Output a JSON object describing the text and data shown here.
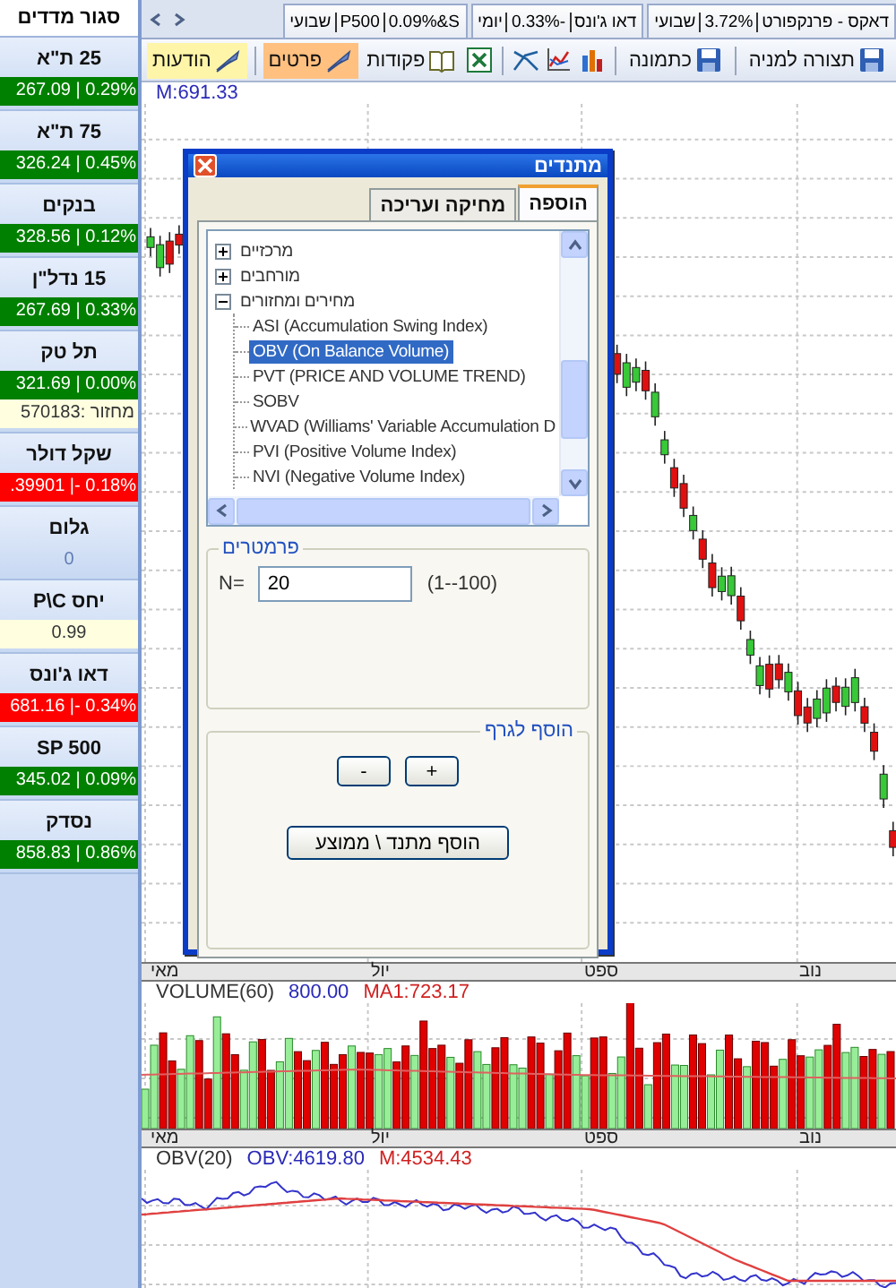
{
  "sidebar": {
    "title": "סגור מדדים",
    "items": [
      {
        "name": "25 ת\"א",
        "value": "267.09 | 0.29%",
        "color": "#008000"
      },
      {
        "name": "75 ת\"א",
        "value": "326.24 | 0.45%",
        "color": "#008000"
      },
      {
        "name": "בנקים",
        "value": "328.56 | 0.12%",
        "color": "#008000"
      },
      {
        "name": "15 נדל\"ן",
        "value": "267.69 | 0.33%",
        "color": "#008000"
      },
      {
        "name": "תל טק",
        "value": "321.69 | 0.00%",
        "color": "#008000",
        "note": "מחזור :570183"
      },
      {
        "name": "שקל דולר",
        "value": ".39901 |- 0.18%",
        "color": "#ff0000"
      },
      {
        "name": "גלום",
        "value": "0"
      },
      {
        "name": "יחס P\\C",
        "value": "0.99",
        "color": "#ffffe0"
      },
      {
        "name": "דאו ג'ונס",
        "value": "681.16 |- 0.34%",
        "color": "#ff0000"
      },
      {
        "name": "SP 500",
        "value": "345.02 | 0.09%",
        "color": "#008000"
      },
      {
        "name": "נסדק",
        "value": "858.83 | 0.86%",
        "color": "#008000"
      }
    ]
  },
  "tabs": [
    {
      "parts": [
        "דאקס - פרנקפורט",
        "3.72%",
        "שבועי"
      ]
    },
    {
      "parts": [
        "דאו ג'ונס",
        "0.33%-",
        "יומי"
      ]
    },
    {
      "parts": [
        "0.09%&S",
        "P500",
        "שבועי"
      ]
    }
  ],
  "toolbar": [
    {
      "label": "תצורה למניה"
    },
    {
      "label": "כתמונה"
    },
    {
      "label": "פקודות"
    },
    {
      "label": "פרטים",
      "color": "#ffc080"
    },
    {
      "label": "הודעות",
      "color": "#fff5a8"
    }
  ],
  "main_chart": {
    "legend": "M:691.33"
  },
  "axis_top": [
    "נוב",
    "ספט",
    "יול",
    "מאי"
  ],
  "volume_panel": {
    "title": "VOLUME(60)",
    "value": "800.00",
    "ma": "MA1:723.17"
  },
  "axis_bottom": [
    "נוב",
    "ספט",
    "יול",
    "מאי"
  ],
  "obv_panel": {
    "title": "OBV(20)",
    "value": "OBV:4619.80",
    "ma": "M:4534.43"
  },
  "dialog": {
    "title": "מתנדים",
    "tabs": [
      {
        "label": "הוספה",
        "selected": true
      },
      {
        "label": "מחיקה ועריכה",
        "selected": false
      }
    ],
    "tree": [
      {
        "label": "מרכזיים",
        "expanded": false,
        "selected": false
      },
      {
        "label": "מורחבים",
        "expanded": false,
        "selected": false
      },
      {
        "label": "מחירים ומחזורים",
        "expanded": true,
        "selected": false,
        "children": [
          {
            "label": "ASI (Accumulation Swing Index)",
            "selected": false
          },
          {
            "label": "OBV (On Balance Volume)",
            "selected": true
          },
          {
            "label": "PVT (PRICE AND VOLUME TREND)",
            "selected": false
          },
          {
            "label": "SOBV",
            "selected": false
          },
          {
            "label": "WVAD (Williams' Variable Accumulation D",
            "selected": false
          },
          {
            "label": "PVI (Positive Volume Index)",
            "selected": false
          },
          {
            "label": "NVI (Negative Volume Index)",
            "selected": false
          }
        ]
      }
    ],
    "params": {
      "legend": "פרמטרים",
      "label": "N=",
      "value": "20",
      "range": "(1--100)"
    },
    "add_group": {
      "legend": "הוסף לגרף",
      "minus": "-",
      "plus": "+",
      "add_button": "הוסף מתנד \\ ממוצע"
    }
  }
}
